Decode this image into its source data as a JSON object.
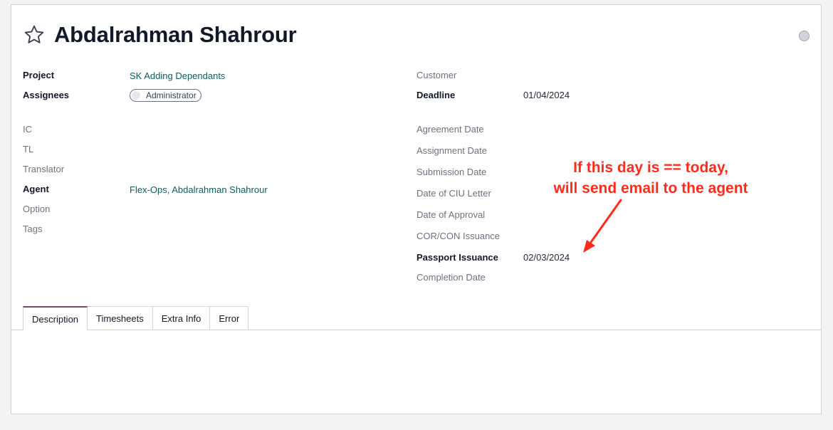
{
  "record": {
    "title": "Abdalrahman Shahrour"
  },
  "left_fields": {
    "project_label": "Project",
    "project_value": "SK Adding Dependants",
    "assignees_label": "Assignees",
    "assignees_tag": "Administrator",
    "ic_label": "IC",
    "tl_label": "TL",
    "translator_label": "Translator",
    "agent_label": "Agent",
    "agent_value": "Flex-Ops, Abdalrahman Shahrour",
    "option_label": "Option",
    "tags_label": "Tags"
  },
  "right_fields": {
    "customer_label": "Customer",
    "deadline_label": "Deadline",
    "deadline_value": "01/04/2024",
    "agreement_date_label": "Agreement Date",
    "assignment_date_label": "Assignment Date",
    "submission_date_label": "Submission Date",
    "ciu_letter_label": "Date of CIU Letter",
    "approval_label": "Date of Approval",
    "cor_con_label": "COR/CON Issuance",
    "passport_label": "Passport Issuance",
    "passport_value": "02/03/2024",
    "completion_label": "Completion Date"
  },
  "annotation": {
    "line1": "If this day is == today,",
    "line2": "will send email to the agent",
    "color": "#ff2a1a"
  },
  "tabs": [
    {
      "label": "Description",
      "active": true
    },
    {
      "label": "Timesheets",
      "active": false
    },
    {
      "label": "Extra Info",
      "active": false
    },
    {
      "label": "Error",
      "active": false
    }
  ],
  "icons": {
    "favorite": "star-icon",
    "status": "status-dot-icon"
  },
  "colors": {
    "link": "#0f5e5b",
    "active_tab": "#714b67"
  }
}
